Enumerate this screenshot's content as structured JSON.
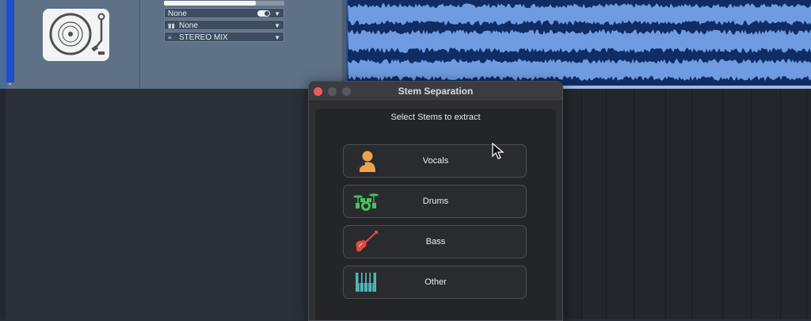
{
  "track": {
    "instrument_icon": "turntable-icon",
    "slider_level": 0.76,
    "input_value": "None",
    "input_toggle": "toggle-icon",
    "instrument_value": "None",
    "output_value": "STEREO MIX",
    "colors": {
      "strip": "#5f7186",
      "track_color": "#1f4fc9"
    }
  },
  "waveform": {
    "color_dark": "#0f2c63",
    "color_light": "#6f9be0"
  },
  "dialog": {
    "title": "Stem Separation",
    "subtitle": "Select Stems to extract",
    "stems": [
      {
        "label": "Vocals",
        "icon": "singer-icon",
        "color": "#f0a24a"
      },
      {
        "label": "Drums",
        "icon": "drum-kit-icon",
        "color": "#43c45a"
      },
      {
        "label": "Bass",
        "icon": "bass-guitar-icon",
        "color": "#e24a3c"
      },
      {
        "label": "Other",
        "icon": "piano-keys-icon",
        "color": "#4fb6b6"
      }
    ]
  }
}
